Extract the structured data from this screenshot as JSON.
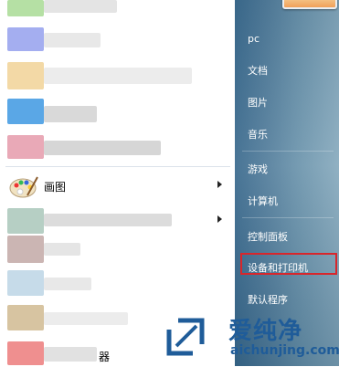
{
  "programs": {
    "paint_label": "画图",
    "bottom_fragment": "器"
  },
  "right_menu": {
    "items": [
      {
        "label": "pc"
      },
      {
        "label": "文档"
      },
      {
        "label": "图片"
      },
      {
        "label": "音乐"
      },
      {
        "label": "游戏"
      },
      {
        "label": "计算机"
      },
      {
        "label": "控制面板"
      },
      {
        "label": "设备和打印机"
      },
      {
        "label": "默认程序"
      }
    ]
  },
  "watermark": {
    "brand_cn": "爱纯净",
    "url": "aichunjing.com"
  },
  "colors": {
    "highlight_border": "#d8262b",
    "watermark_blue": "#1f5c99"
  }
}
